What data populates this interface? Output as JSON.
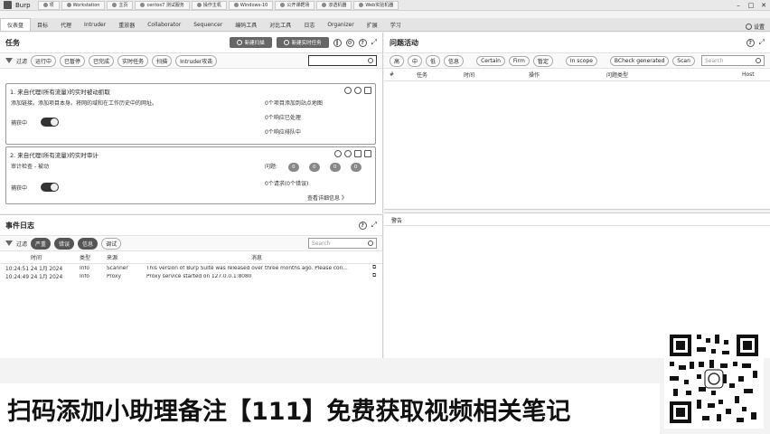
{
  "titlebar": {
    "app": "Burp",
    "tabs": [
      "项",
      "Workstation",
      "主页",
      "centos7 测试服务",
      "操作主机",
      "Windows-10",
      "公开课靶场",
      "渗透机器",
      "Web实验机器"
    ]
  },
  "nav": {
    "tabs": [
      "仪表盘",
      "目标",
      "代理",
      "Intruder",
      "重放器",
      "Collaborator",
      "Sequencer",
      "编码工具",
      "对比工具",
      "日志",
      "Organizer",
      "扩展",
      "学习"
    ],
    "settings": "设置"
  },
  "tasks": {
    "title": "任务",
    "new_scan": "新建扫描",
    "new_live_task": "新建实时任务",
    "filter_label": "过滤",
    "chips": [
      "运行中",
      "已暂停",
      "已完成",
      "实时任务",
      "扫描",
      "Intruder攻击"
    ],
    "search_placeholder": "",
    "cards": [
      {
        "title": "1. 来自代理(所有流量)的实时被动抓取",
        "desc": "添加链接。添加项目本身。将网的域和在工作历史中的网址。",
        "status": "捕获中",
        "stats": [
          "0个项目添加到站点地图",
          "0个响应已处理",
          "0个响应排队中"
        ]
      },
      {
        "title": "2. 来自代理(所有流量)的实时审计",
        "desc": "审计检查 - 被动",
        "status": "捕获中",
        "issues_label": "问题:",
        "issue_counts": [
          "0",
          "0",
          "0",
          "0"
        ],
        "requests": "0个请求(0个错误)",
        "details_link": "查看详细信息 》"
      }
    ]
  },
  "issues": {
    "title": "问题活动",
    "chips": [
      "高",
      "中",
      "低",
      "信息",
      "Certain",
      "Firm",
      "暂定",
      "In scope",
      "BCheck generated",
      "Scan"
    ],
    "search_placeholder": "Search",
    "columns": [
      "#",
      "任务",
      "时间",
      "操作",
      "问题类型",
      "Host"
    ],
    "advisory_label": "警告"
  },
  "eventlog": {
    "title": "事件日志",
    "filter_label": "过滤",
    "chips": [
      "严重",
      "错误",
      "信息",
      "调试"
    ],
    "search_placeholder": "Search",
    "columns": [
      "时间",
      "类型",
      "来源",
      "消息"
    ],
    "rows": [
      {
        "time": "10:24:51 24 1月 2024",
        "type": "Info",
        "source": "Scanner",
        "message": "This version of Burp Suite was released over three months ago. Please con..."
      },
      {
        "time": "10:24:49 24 1月 2024",
        "type": "Info",
        "source": "Proxy",
        "message": "Proxy service started on 127.0.0.1:8080"
      }
    ]
  },
  "banner": {
    "text": "扫码添加小助理备注【111】免费获取视频相关笔记"
  }
}
